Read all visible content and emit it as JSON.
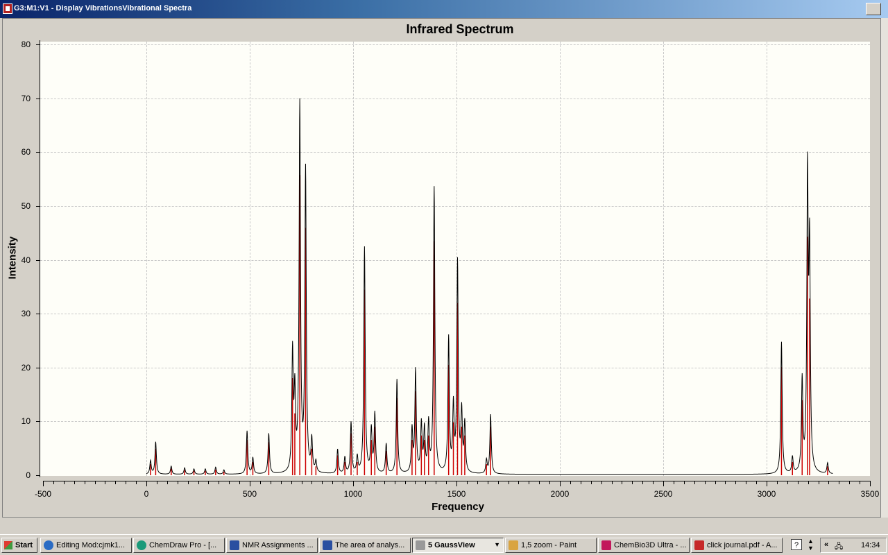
{
  "window": {
    "title": "G3:M1:V1 - Display VibrationsVibrational Spectra"
  },
  "chart_data": {
    "type": "line",
    "title": "Infrared Spectrum",
    "xlabel": "Frequency",
    "ylabel": "Intensity",
    "xlim": [
      -500,
      3500
    ],
    "ylim": [
      0,
      80
    ],
    "x_ticks": [
      "-500",
      "0",
      "500",
      "1000",
      "1500",
      "2000",
      "2500",
      "3000",
      "3500"
    ],
    "y_ticks": [
      "0",
      "10",
      "20",
      "30",
      "40",
      "50",
      "60",
      "70",
      "80"
    ],
    "grid": true,
    "colors": {
      "curve": "#000000",
      "sticks": "#cc0000",
      "background": "#fefef8"
    },
    "peaks": [
      {
        "x": 20,
        "y": 2.5
      },
      {
        "x": 45,
        "y": 6
      },
      {
        "x": 120,
        "y": 1.5
      },
      {
        "x": 185,
        "y": 1.2
      },
      {
        "x": 230,
        "y": 1
      },
      {
        "x": 285,
        "y": 1
      },
      {
        "x": 335,
        "y": 1.3
      },
      {
        "x": 375,
        "y": 0.8
      },
      {
        "x": 487,
        "y": 8
      },
      {
        "x": 515,
        "y": 3
      },
      {
        "x": 592,
        "y": 7.5
      },
      {
        "x": 707,
        "y": 22
      },
      {
        "x": 718,
        "y": 14
      },
      {
        "x": 742,
        "y": 68
      },
      {
        "x": 770,
        "y": 56
      },
      {
        "x": 800,
        "y": 6
      },
      {
        "x": 820,
        "y": 2
      },
      {
        "x": 925,
        "y": 4.5
      },
      {
        "x": 960,
        "y": 3
      },
      {
        "x": 990,
        "y": 9.5
      },
      {
        "x": 1020,
        "y": 3
      },
      {
        "x": 1055,
        "y": 42
      },
      {
        "x": 1088,
        "y": 8
      },
      {
        "x": 1105,
        "y": 11
      },
      {
        "x": 1160,
        "y": 5.5
      },
      {
        "x": 1212,
        "y": 17.5
      },
      {
        "x": 1285,
        "y": 8
      },
      {
        "x": 1302,
        "y": 19
      },
      {
        "x": 1330,
        "y": 9
      },
      {
        "x": 1345,
        "y": 8
      },
      {
        "x": 1365,
        "y": 9
      },
      {
        "x": 1392,
        "y": 53
      },
      {
        "x": 1462,
        "y": 25
      },
      {
        "x": 1485,
        "y": 12
      },
      {
        "x": 1505,
        "y": 39
      },
      {
        "x": 1525,
        "y": 11
      },
      {
        "x": 1540,
        "y": 9
      },
      {
        "x": 1645,
        "y": 2.5
      },
      {
        "x": 1665,
        "y": 11
      },
      {
        "x": 3072,
        "y": 24.5
      },
      {
        "x": 3125,
        "y": 3
      },
      {
        "x": 3172,
        "y": 17
      },
      {
        "x": 3198,
        "y": 54
      },
      {
        "x": 3208,
        "y": 40
      },
      {
        "x": 3295,
        "y": 2
      }
    ]
  },
  "taskbar": {
    "start_label": "Start",
    "items": [
      "Editing Mod:cjmk1...",
      "ChemDraw Pro - [...",
      "NMR Assignments ...",
      "The area of analys...",
      "5 GaussView",
      "1,5 zoom - Paint",
      "ChemBio3D Ultra - ...",
      "click journal.pdf - A..."
    ],
    "help_label": "?",
    "clock": "14:34"
  }
}
